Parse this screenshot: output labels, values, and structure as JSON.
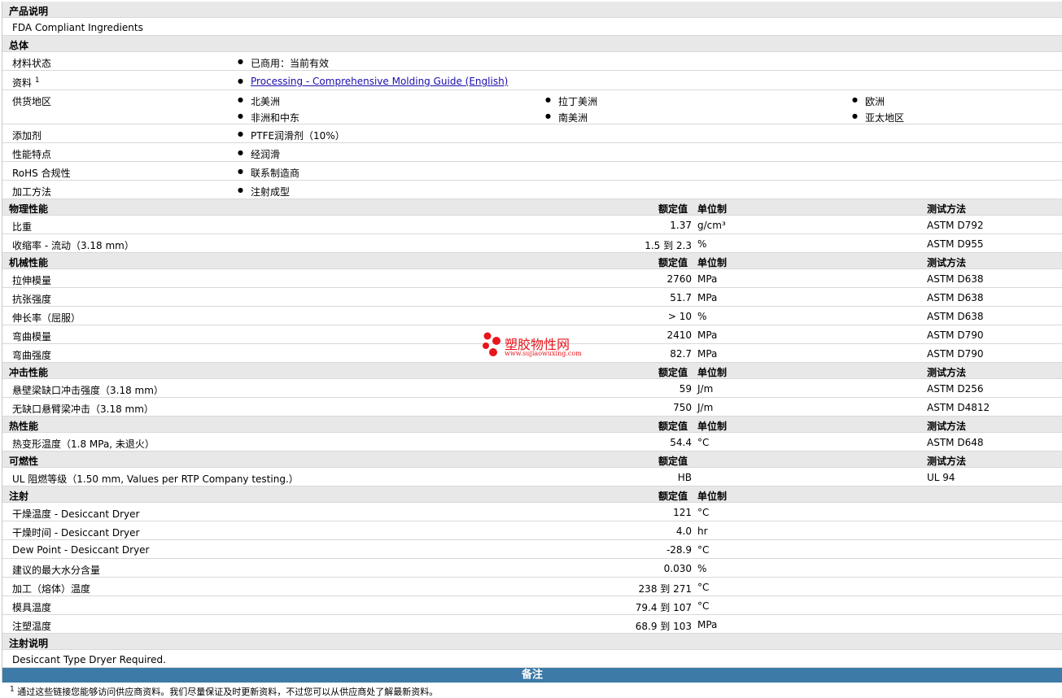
{
  "sections": {
    "desc_title": "产品说明",
    "desc_text": "FDA Compliant Ingredients",
    "general_title": "总体",
    "material_status_label": "材料状态",
    "material_status_value": "已商用：当前有效",
    "docs_label": "资料",
    "docs_sup": "1",
    "docs_link": "Processing - Comprehensive Molding Guide (English)",
    "supply_label": "供货地区",
    "supply_regions": [
      "北美洲",
      "拉丁美洲",
      "欧洲",
      "非洲和中东",
      "南美洲",
      "亚太地区"
    ],
    "additive_label": "添加剂",
    "additive_value": "PTFE润滑剂（10%）",
    "features_label": "性能特点",
    "features_value": "经润滑",
    "rohs_label": "RoHS 合规性",
    "rohs_value": "联系制造商",
    "process_label": "加工方法",
    "process_value": "注射成型"
  },
  "headers": {
    "nominal": "额定值",
    "unit": "单位制",
    "test": "测试方法"
  },
  "physical": {
    "title": "物理性能",
    "rows": [
      {
        "label": "比重",
        "value": "1.37",
        "unit": "g/cm³",
        "test": "ASTM D792"
      },
      {
        "label": "收缩率  - 流动（3.18 mm）",
        "value": "1.5 到  2.3",
        "unit": "%",
        "test": "ASTM D955"
      }
    ]
  },
  "mechanical": {
    "title": "机械性能",
    "rows": [
      {
        "label": "拉伸模量",
        "value": "2760",
        "unit": "MPa",
        "test": "ASTM D638"
      },
      {
        "label": "抗张强度",
        "value": "51.7",
        "unit": "MPa",
        "test": "ASTM D638"
      },
      {
        "label": "伸长率（屈服）",
        "value": "> 10",
        "unit": "%",
        "test": "ASTM D638"
      },
      {
        "label": "弯曲模量",
        "value": "2410",
        "unit": "MPa",
        "test": "ASTM D790"
      },
      {
        "label": "弯曲强度",
        "value": "82.7",
        "unit": "MPa",
        "test": "ASTM D790"
      }
    ]
  },
  "impact": {
    "title": "冲击性能",
    "rows": [
      {
        "label": "悬壁梁缺口冲击强度（3.18 mm）",
        "value": "59",
        "unit": "J/m",
        "test": "ASTM D256"
      },
      {
        "label": "无缺口悬臂梁冲击（3.18 mm）",
        "value": "750",
        "unit": "J/m",
        "test": "ASTM D4812"
      }
    ]
  },
  "thermal": {
    "title": "热性能",
    "rows": [
      {
        "label": "热变形温度（1.8 MPa, 未退火）",
        "value": "54.4",
        "unit": "°C",
        "test": "ASTM D648"
      }
    ]
  },
  "flammability": {
    "title": "可燃性",
    "rows": [
      {
        "label": "UL 阻燃等级（1.50 mm, Values per RTP Company testing.）",
        "value": "HB",
        "unit": "",
        "test": "UL 94"
      }
    ]
  },
  "injection": {
    "title": "注射",
    "rows": [
      {
        "label": "干燥温度  - Desiccant Dryer",
        "value": "121",
        "unit": "°C"
      },
      {
        "label": "干燥时间  - Desiccant Dryer",
        "value": "4.0",
        "unit": "hr"
      },
      {
        "label": "Dew Point - Desiccant Dryer",
        "value": "-28.9",
        "unit": "°C"
      },
      {
        "label": "建议的最大水分含量",
        "value": "0.030",
        "unit": "%"
      },
      {
        "label": "加工（熔体）温度",
        "value": "238 到  271",
        "unit": "°C"
      },
      {
        "label": "模具温度",
        "value": "79.4 到  107",
        "unit": "°C"
      },
      {
        "label": "注塑温度",
        "value": "68.9 到  103",
        "unit": "MPa"
      }
    ]
  },
  "injection_notes": {
    "title": "注射说明",
    "text": "Desiccant Type Dryer Required."
  },
  "notes_bar": "备注",
  "footnote": {
    "sup": "1",
    "text": "通过这些链接您能够访问供应商资料。我们尽量保证及时更新资料，不过您可以从供应商处了解最新资料。"
  },
  "watermark": {
    "title": "塑胶物性网",
    "url": "www.sujiaowuxing.com",
    "accent": "#e8151b"
  }
}
